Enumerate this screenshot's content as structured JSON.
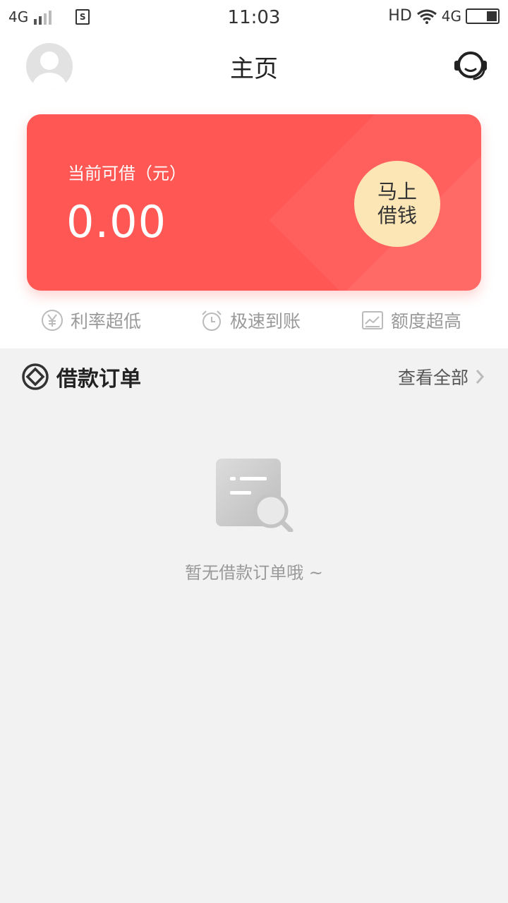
{
  "status_bar": {
    "network_left": "4G",
    "time": "11:03",
    "hd": "HD",
    "network_right": "4G",
    "icons": [
      "signal-icon",
      "sim-icon",
      "wifi-icon",
      "battery-icon"
    ]
  },
  "header": {
    "title": "主页",
    "icons": [
      "avatar-icon",
      "customer-service-icon"
    ]
  },
  "card": {
    "label": "当前可借（元）",
    "amount": "0.00",
    "button_line1": "马上",
    "button_line2": "借钱",
    "colors": {
      "card": "#ff5753",
      "button": "#fde6b6"
    }
  },
  "features": [
    {
      "icon": "yuan-icon",
      "label": "利率超低"
    },
    {
      "icon": "alarm-clock-icon",
      "label": "极速到账"
    },
    {
      "icon": "chart-icon",
      "label": "额度超高"
    }
  ],
  "orders": {
    "title": "借款订单",
    "view_all": "查看全部",
    "empty_text": "暂无借款订单哦 ~"
  }
}
